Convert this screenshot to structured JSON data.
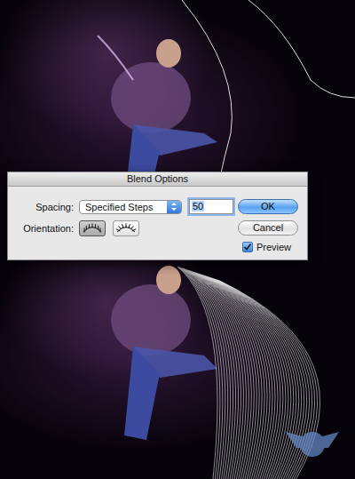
{
  "dialog": {
    "title": "Blend Options",
    "spacing": {
      "label": "Spacing:",
      "value": "Specified Steps",
      "steps": "50"
    },
    "orientation": {
      "label": "Orientation:",
      "options": [
        {
          "kind": "page",
          "selected": true
        },
        {
          "kind": "path",
          "selected": false
        }
      ]
    },
    "buttons": [
      {
        "label": "OK",
        "default": true
      },
      {
        "label": "Cancel",
        "default": false
      }
    ],
    "preview": {
      "label": "Preview",
      "checked": true
    }
  }
}
